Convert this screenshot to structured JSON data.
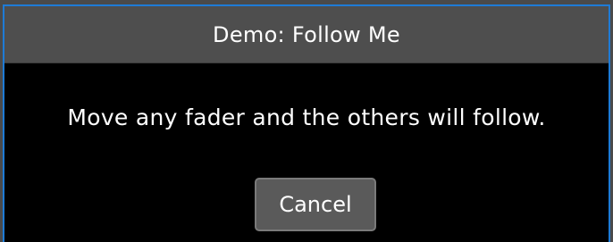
{
  "dialog": {
    "title": "Demo: Follow Me",
    "message": "Move any fader and the others will follow.",
    "cancel_label": "Cancel"
  },
  "colors": {
    "border_accent": "#1e7bd6",
    "title_bar": "#4e4e4e",
    "body_background": "#000000",
    "button_background": "#5a5a5a"
  }
}
